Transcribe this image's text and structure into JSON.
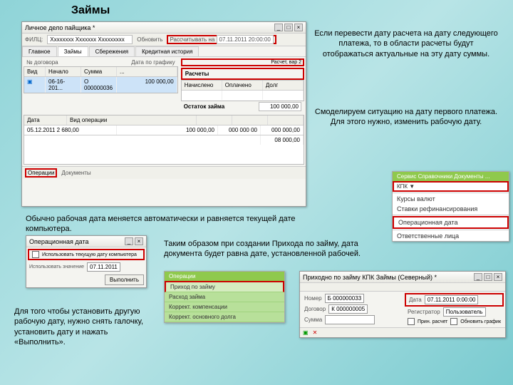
{
  "slide": {
    "title": "Займы"
  },
  "main_win": {
    "title": "Личное дело пайщика *",
    "name_field": "Хххххххх Ххххххх Ххххххххх",
    "btn_refresh": "Обновить",
    "btn_calc": "Рассчитывать на",
    "calc_date": "07.11.2011 20:00:00",
    "tabs": [
      "Главное",
      "Займы",
      "Сбережения",
      "Кредитная история"
    ],
    "col_contract": "№ договора",
    "col_date": "Дата по графику",
    "contract_no": "06-16-201...",
    "contract_ref": "О 000000036",
    "sum": "100 000,00",
    "grid2_h": [
      "Вид",
      "Начало",
      "Сумма",
      "..."
    ],
    "grid2_row": [
      "1",
      "Расчет, вар 2",
      "..."
    ],
    "section_calc": "Расчеты",
    "calc_cols": [
      "Начислено",
      "Оплачено",
      "Долг"
    ],
    "section_remain": "Остаток займа",
    "remain_val": "100 000,00",
    "sched_h": [
      "Дата",
      "Вид операции",
      "...",
      "..."
    ],
    "sched_r0": "05.12.2011 2 680,00",
    "sched_r1": "100 000,00",
    "sched_r2": "000 000 00",
    "sched_r3": "000 000,00",
    "sched_r4": "08 000,00",
    "bottom_btn1": "Операции",
    "bottom_btn2": "Документы"
  },
  "note1": "Если перевести дату расчета на дату следующего платежа, то в области расчеты будут отображаться актуальные на эту дату суммы.",
  "note2": "Смоделируем ситуацию на дату первого платежа. Для этого нужно, изменить рабочую дату.",
  "note3": "Обычно рабочая дата меняется автоматически и равняется текущей дате компьютера.",
  "note4": "Таким образом при создании Прихода по займу, дата документа будет равна дате, установленной рабочей.",
  "note5": "Для того чтобы установить другую рабочую дату, нужно снять галочку, установить дату и нажать «Выполнить».",
  "menu1": {
    "head": "Сервис   Справочники   Документы   ...",
    "items": [
      "Курсы валют",
      "Ставки рефинансирования",
      "Операционная дата",
      "Ответственные лица"
    ]
  },
  "dlg_date": {
    "title": "Операционная дата",
    "chk_label": "Использовать текущую дату компьютера",
    "use_label": "Использовать значение",
    "date_val": "07.11.2011",
    "btn": "Выполнить"
  },
  "ops_menu": {
    "head": "Операции",
    "sel": "Приход по займу",
    "items": [
      "Расход займа",
      "Коррект. компенсации",
      "Коррект. основного долга"
    ]
  },
  "doc_win": {
    "title": "Приходно по займу КПК Займы (Северный) *",
    "num_label": "Номер",
    "num": "Б 000000033",
    "date_label": "Дата",
    "date": "07.11.2011 0:00:00",
    "contract_label": "Договор",
    "contract": "К 000000005",
    "reg_label": "Регистратор",
    "reg": "Пользователь",
    "sum_label": "Сумма",
    "chk1": "Прин. расчет",
    "chk2": "Обновить график",
    "ok": "OK",
    "cancel": "✕"
  }
}
